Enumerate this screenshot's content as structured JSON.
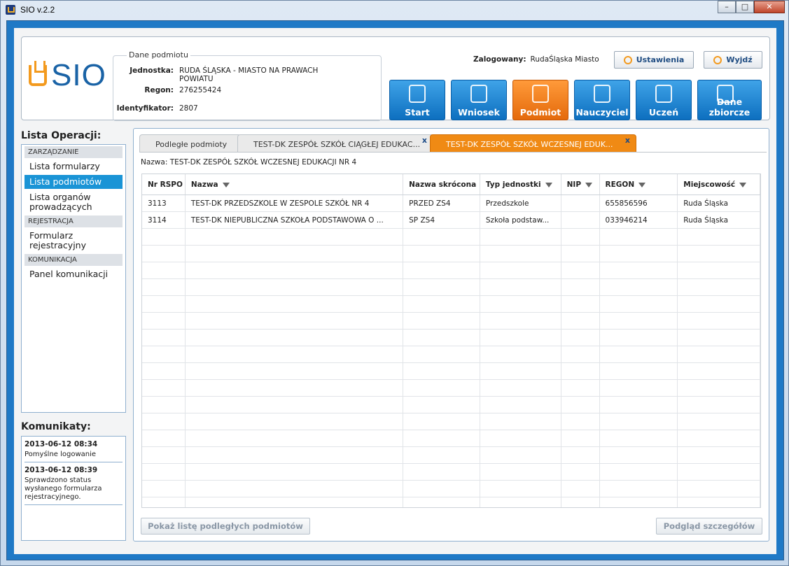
{
  "window": {
    "title": "SIO v.2.2",
    "min": "–",
    "max": "□",
    "close": "✕"
  },
  "logo": {
    "text": "SIO"
  },
  "dane": {
    "legend": "Dane podmiotu",
    "jednostka_label": "Jednostka:",
    "jednostka_value": "RUDA ŚLĄSKA - MIASTO NA PRAWACH POWIATU",
    "regon_label": "Regon:",
    "regon_value": "276255424",
    "identyfikator_label": "Identyfikator:",
    "identyfikator_value": "2807"
  },
  "login": {
    "label": "Zalogowany:",
    "user": "RudaŚląska Miasto"
  },
  "top_buttons": {
    "settings": "Ustawienia",
    "exit": "Wyjdź"
  },
  "nav": [
    {
      "label": "Start",
      "icon": "play-icon"
    },
    {
      "label": "Wniosek",
      "icon": "database-icon"
    },
    {
      "label": "Podmiot",
      "icon": "building-icon",
      "active": true
    },
    {
      "label": "Nauczyciel",
      "icon": "teacher-icon"
    },
    {
      "label": "Uczeń",
      "icon": "student-icon"
    },
    {
      "label": "Dane zbiorcze",
      "icon": "stack-icon"
    }
  ],
  "left": {
    "title": "Lista Operacji:",
    "cat1": "ZARZĄDZANIE",
    "item1": "Lista formularzy",
    "item2": "Lista podmiotów",
    "item3": "Lista organów prowadzących",
    "cat2": "REJESTRACJA",
    "item4": "Formularz rejestracyjny",
    "cat3": "KOMUNIKACJA",
    "item5": "Panel komunikacji"
  },
  "komunikaty": {
    "title": "Komunikaty:",
    "m1_date": "2013-06-12 08:34",
    "m1_text": "Pomyślne logowanie",
    "m2_date": "2013-06-12 08:39",
    "m2_text": "Sprawdzono status wysłanego formularza rejestracyjnego."
  },
  "tabs": {
    "t1": "Podległe podmioty",
    "t2": "TEST-DK ZESPÓŁ SZKÓŁ CIĄGŁEJ EDUKAC...",
    "t3": "TEST-DK ZESPÓŁ SZKÓŁ WCZESNEJ EDUK...",
    "close": "x"
  },
  "nazwa": "Nazwa: TEST-DK ZESPÓŁ SZKÓŁ WCZESNEJ EDUKACJI NR 4",
  "grid": {
    "headers": [
      "Nr RSPO",
      "Nazwa",
      "Nazwa skrócona",
      "Typ jednostki",
      "NIP",
      "REGON",
      "Miejscowość"
    ],
    "rows": [
      [
        "3113",
        "TEST-DK PRZEDSZKOLE W ZESPOLE SZKÓŁ NR 4",
        "PRZED ZS4",
        "Przedszkole",
        "",
        "655856596",
        "Ruda Śląska"
      ],
      [
        "3114",
        "TEST-DK NIEPUBLICZNA SZKOŁA PODSTAWOWA O ...",
        "SP ZS4",
        "Szkoła podstaw...",
        "",
        "033946214",
        "Ruda Śląska"
      ]
    ]
  },
  "bottom_buttons": {
    "show_list": "Pokaż listę podległych podmiotów",
    "details": "Podgląd szczegółów"
  }
}
